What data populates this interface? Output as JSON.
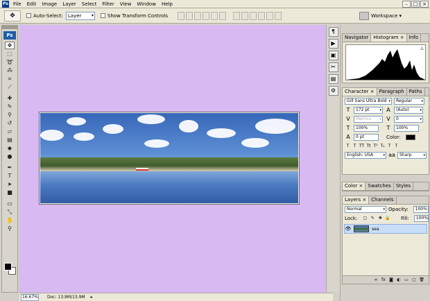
{
  "menubar": {
    "logo": "Ps",
    "items": [
      "File",
      "Edit",
      "Image",
      "Layer",
      "Select",
      "Filter",
      "View",
      "Window",
      "Help"
    ],
    "window_controls": [
      "–",
      "□",
      "×"
    ]
  },
  "options_bar": {
    "tool_icon": "move-tool-icon",
    "auto_select_label": "Auto-Select:",
    "auto_select_value": "Layer",
    "show_transform_label": "Show Transform Controls",
    "workspace_label": "Workspace ▾"
  },
  "toolbox": {
    "logo": "Ps",
    "tools": [
      "move",
      "marquee",
      "lasso",
      "magic-wand",
      "crop",
      "slice",
      "healing",
      "brush",
      "clone-stamp",
      "history-brush",
      "eraser",
      "gradient",
      "blur",
      "dodge",
      "pen",
      "type",
      "path-select",
      "shape",
      "notes",
      "eyedropper",
      "hand",
      "zoom"
    ]
  },
  "status_bar": {
    "zoom": "16.67%",
    "doc_info": "Doc: 13.9M/13.9M"
  },
  "panels": {
    "nav_tabs": [
      "Navigator",
      "Histogram ×",
      "Info"
    ],
    "histogram_warning": "⚠",
    "char_tabs": [
      "Character ×",
      "Paragraph",
      "Paths"
    ],
    "font_family": "Gill Sans Ultra Bold",
    "font_style": "Regular",
    "font_size": "172 pt",
    "leading": "(Auto)",
    "kerning": "Metrics",
    "tracking": "0",
    "vscale": "100%",
    "hscale": "100%",
    "baseline": "0 pt",
    "color_label": "Color:",
    "language": "English: USA",
    "antialias_icon": "aa",
    "antialias": "Sharp",
    "color_tabs": [
      "Color ×",
      "Swatches",
      "Styles"
    ],
    "layer_tabs": [
      "Layers ×",
      "Channels"
    ],
    "blend_mode": "Normal",
    "opacity_label": "Opacity:",
    "opacity": "100%",
    "lock_label": "Lock:",
    "fill_label": "Fill:",
    "fill": "100%",
    "layer_name": "sea"
  },
  "colors": {
    "canvas_bg": "#d8b9f2",
    "selection": "#c8ddf8"
  }
}
